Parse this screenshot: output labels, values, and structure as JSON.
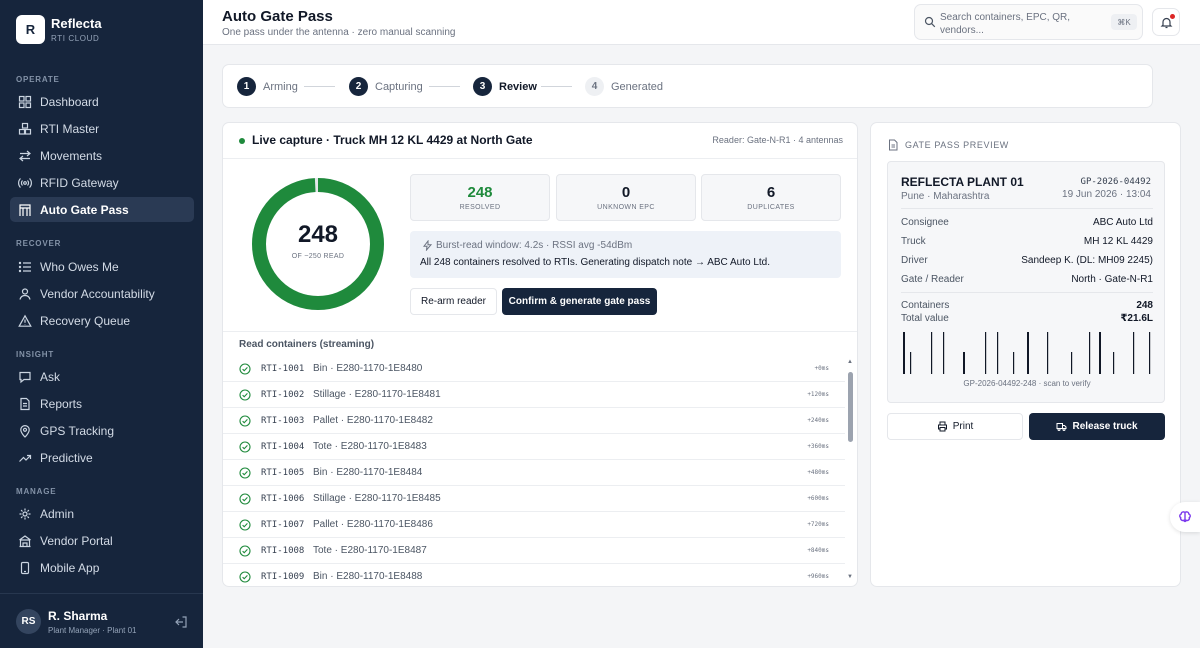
{
  "brand": {
    "initial": "R",
    "name": "Reflecta",
    "sub": "RTI CLOUD"
  },
  "nav": {
    "sections": [
      {
        "label": "OPERATE",
        "items": [
          {
            "label": "Dashboard",
            "icon": "dashboard-icon"
          },
          {
            "label": "RTI Master",
            "icon": "boxes-icon"
          },
          {
            "label": "Movements",
            "icon": "arrows-icon"
          },
          {
            "label": "RFID Gateway",
            "icon": "rfid-icon"
          },
          {
            "label": "Auto Gate Pass",
            "icon": "gate-icon",
            "active": true
          }
        ]
      },
      {
        "label": "RECOVER",
        "items": [
          {
            "label": "Who Owes Me",
            "icon": "list-icon"
          },
          {
            "label": "Vendor Accountability",
            "icon": "users-icon"
          },
          {
            "label": "Recovery Queue",
            "icon": "warning-icon"
          }
        ]
      },
      {
        "label": "INSIGHT",
        "items": [
          {
            "label": "Ask",
            "icon": "chat-icon"
          },
          {
            "label": "Reports",
            "icon": "document-icon"
          },
          {
            "label": "GPS Tracking",
            "icon": "pin-icon"
          },
          {
            "label": "Predictive",
            "icon": "trend-icon"
          }
        ]
      },
      {
        "label": "MANAGE",
        "items": [
          {
            "label": "Admin",
            "icon": "gear-icon"
          },
          {
            "label": "Vendor Portal",
            "icon": "building-icon"
          },
          {
            "label": "Mobile App",
            "icon": "phone-icon"
          }
        ]
      }
    ]
  },
  "user": {
    "initials": "RS",
    "name": "R. Sharma",
    "role": "Plant Manager · Plant 01"
  },
  "header": {
    "title": "Auto Gate Pass",
    "subtitle": "One pass under the antenna · zero manual scanning",
    "search_placeholder": "Search containers, EPC, QR, vendors...",
    "search_shortcut": "⌘K"
  },
  "stepper": [
    {
      "num": "1",
      "label": "Arming",
      "state": "done"
    },
    {
      "num": "2",
      "label": "Capturing",
      "state": "done"
    },
    {
      "num": "3",
      "label": "Review",
      "state": "current"
    },
    {
      "num": "4",
      "label": "Generated",
      "state": "pending"
    }
  ],
  "capture": {
    "title": "Live capture · Truck MH 12 KL 4429 at North Gate",
    "reader": "Reader: Gate-N-R1 · 4 antennas",
    "gauge_value": "248",
    "gauge_sub": "OF ~250 READ",
    "gauge_fraction": 0.992,
    "stats": [
      {
        "value": "248",
        "label": "RESOLVED"
      },
      {
        "value": "0",
        "label": "UNKNOWN EPC"
      },
      {
        "value": "6",
        "label": "DUPLICATES"
      }
    ],
    "info_line1": "Burst-read window: 4.2s · RSSI avg -54dBm",
    "info_line2": "All 248 containers resolved to RTIs. Generating dispatch note → ABC Auto Ltd.",
    "rearm_label": "Re-arm reader",
    "confirm_label": "Confirm & generate gate pass",
    "list_title": "Read containers (streaming)",
    "rows": [
      {
        "id": "RTI-1001",
        "desc": "Bin · E280-1170-1E8480",
        "time": "+0ms"
      },
      {
        "id": "RTI-1002",
        "desc": "Stillage · E280-1170-1E8481",
        "time": "+120ms"
      },
      {
        "id": "RTI-1003",
        "desc": "Pallet · E280-1170-1E8482",
        "time": "+240ms"
      },
      {
        "id": "RTI-1004",
        "desc": "Tote · E280-1170-1E8483",
        "time": "+360ms"
      },
      {
        "id": "RTI-1005",
        "desc": "Bin · E280-1170-1E8484",
        "time": "+480ms"
      },
      {
        "id": "RTI-1006",
        "desc": "Stillage · E280-1170-1E8485",
        "time": "+600ms"
      },
      {
        "id": "RTI-1007",
        "desc": "Pallet · E280-1170-1E8486",
        "time": "+720ms"
      },
      {
        "id": "RTI-1008",
        "desc": "Tote · E280-1170-1E8487",
        "time": "+840ms"
      },
      {
        "id": "RTI-1009",
        "desc": "Bin · E280-1170-1E8488",
        "time": "+960ms"
      }
    ]
  },
  "preview": {
    "label": "GATE PASS PREVIEW",
    "plant": "REFLECTA PLANT 01",
    "location": "Pune · Maharashtra",
    "gp_number": "GP-2026-04492",
    "date": "19 Jun 2026 · 13:04",
    "fields": [
      {
        "key": "Consignee",
        "value": "ABC Auto Ltd"
      },
      {
        "key": "Truck",
        "value": "MH 12 KL 4429"
      },
      {
        "key": "Driver",
        "value": "Sandeep K. (DL: MH09 2245)"
      },
      {
        "key": "Gate / Reader",
        "value": "North · Gate-N-R1"
      }
    ],
    "containers_label": "Containers",
    "containers_value": "248",
    "total_label": "Total value",
    "total_value": "₹21.6L",
    "barcode_caption": "GP-2026-04492-248 · scan to verify",
    "print_label": "Print",
    "release_label": "Release truck"
  },
  "colors": {
    "sidebar": "#16253c",
    "accent": "#16253c",
    "success": "#1f8a3c"
  }
}
